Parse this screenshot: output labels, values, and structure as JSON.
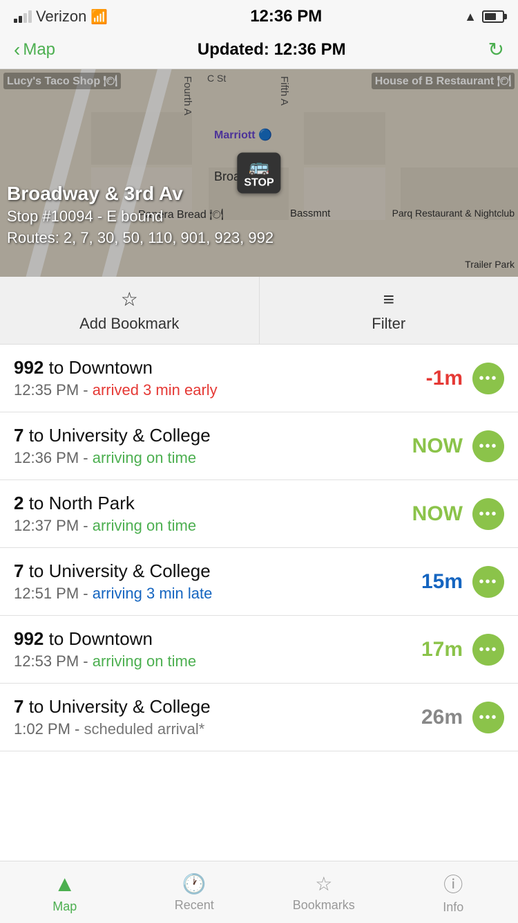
{
  "statusBar": {
    "carrier": "Verizon",
    "time": "12:36 PM"
  },
  "navBar": {
    "backLabel": "Map",
    "title": "Updated: 12:36 PM",
    "refreshIcon": "↻"
  },
  "mapOverlay": {
    "line1": "Broadway & 3rd Av",
    "line2": "Stop #10094 - E bound",
    "line3": "Routes: 2, 7, 30, 50, 110, 901, 923, 992"
  },
  "actionButtons": [
    {
      "icon": "☆",
      "label": "Add Bookmark"
    },
    {
      "icon": "≡",
      "label": "Filter"
    }
  ],
  "busList": [
    {
      "routeNum": "992",
      "destination": "to Downtown",
      "time": "12:35 PM",
      "statusText": "arrived 3 min early",
      "statusClass": "status-early",
      "eta": "-1m",
      "etaClass": "early"
    },
    {
      "routeNum": "7",
      "destination": "to University & College",
      "time": "12:36 PM",
      "statusText": "arriving on time",
      "statusClass": "status-on-time",
      "eta": "NOW",
      "etaClass": "on-time"
    },
    {
      "routeNum": "2",
      "destination": "to North Park",
      "time": "12:37 PM",
      "statusText": "arriving on time",
      "statusClass": "status-on-time",
      "eta": "NOW",
      "etaClass": "on-time"
    },
    {
      "routeNum": "7",
      "destination": "to University & College",
      "time": "12:51 PM",
      "statusText": "arriving 3 min late",
      "statusClass": "status-late",
      "eta": "15m",
      "etaClass": "late-blue"
    },
    {
      "routeNum": "992",
      "destination": "to Downtown",
      "time": "12:53 PM",
      "statusText": "arriving on time",
      "statusClass": "status-on-time",
      "eta": "17m",
      "etaClass": "neutral"
    },
    {
      "routeNum": "7",
      "destination": "to University & College",
      "time": "1:02 PM",
      "statusText": "scheduled arrival*",
      "statusClass": "status-scheduled",
      "eta": "26m",
      "etaClass": "gray"
    }
  ],
  "tabBar": [
    {
      "icon": "▲",
      "label": "Map",
      "active": true
    },
    {
      "icon": "🕐",
      "label": "Recent",
      "active": false
    },
    {
      "icon": "☆",
      "label": "Bookmarks",
      "active": false
    },
    {
      "icon": "ⓘ",
      "label": "Info",
      "active": false
    }
  ]
}
